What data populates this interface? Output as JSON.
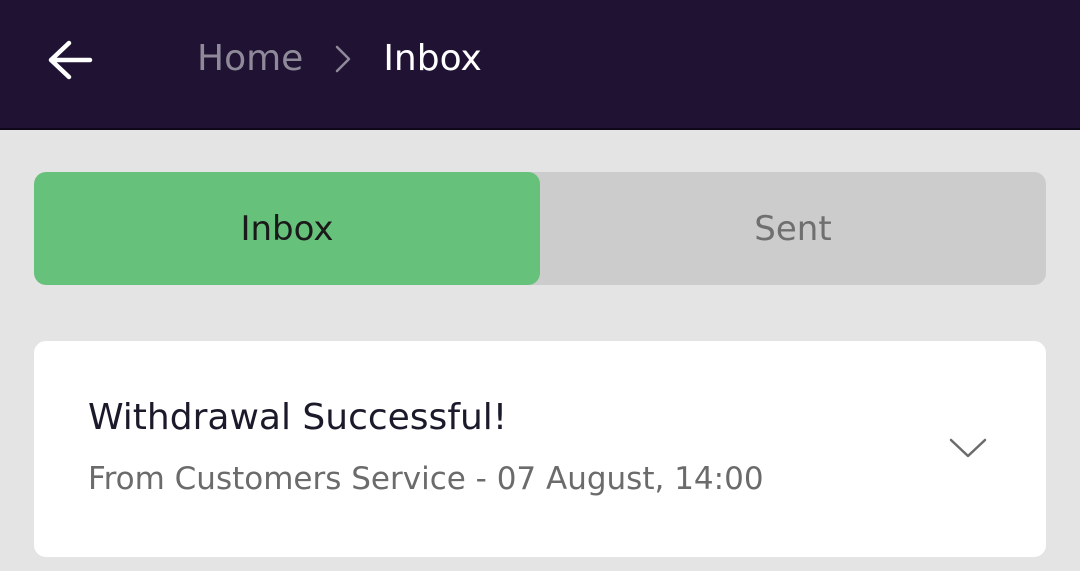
{
  "header": {
    "back_icon": "arrow-left-icon",
    "breadcrumb": {
      "home": "Home",
      "separator_icon": "chevron-right-icon",
      "current": "Inbox"
    }
  },
  "tabs": [
    {
      "label": "Inbox",
      "active": true
    },
    {
      "label": "Sent",
      "active": false
    }
  ],
  "messages": [
    {
      "title": "Withdrawal Successful!",
      "meta": "From Customers Service - 07 August, 14:00",
      "expand_icon": "chevron-down-icon"
    }
  ],
  "colors": {
    "header_bg": "#1f1233",
    "page_bg": "#e4e4e4",
    "tab_active": "#66c17b",
    "tab_inactive": "#cccccc",
    "card_bg": "#ffffff"
  }
}
